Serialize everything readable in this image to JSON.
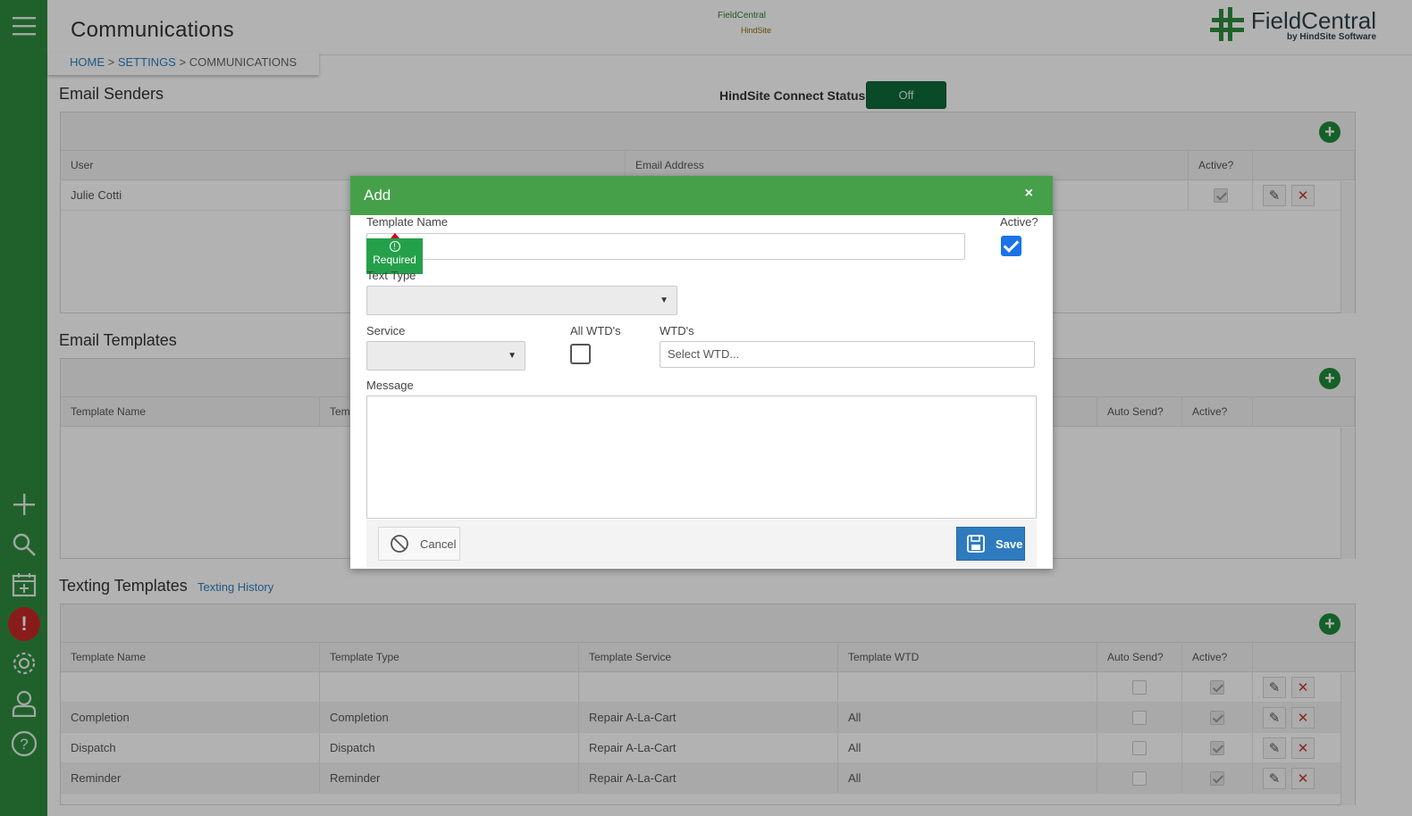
{
  "page": {
    "title": "Communications",
    "breadcrumb": {
      "home": "HOME",
      "settings": "SETTINGS",
      "current": "COMMUNICATIONS",
      "sep": ">"
    },
    "center_logo": {
      "top": "FieldCentral",
      "bottom": "HindSite"
    },
    "brand": {
      "name": "FieldCentral",
      "sub": "by HindSite Software"
    }
  },
  "email_senders": {
    "title": "Email Senders",
    "connect_label": "HindSite Connect Status:",
    "connect_value": "Off",
    "columns": [
      "User",
      "Email Address",
      "Active?"
    ],
    "rows": [
      {
        "user": "Julie Cotti",
        "email": "",
        "active": true
      }
    ]
  },
  "email_templates": {
    "title": "Email Templates",
    "columns": [
      "Template Name",
      "Tem",
      "Auto Send?",
      "Active?"
    ]
  },
  "texting_templates": {
    "title": "Texting Templates",
    "history_link": "Texting History",
    "columns": [
      "Template Name",
      "Template Type",
      "Template Service",
      "Template WTD",
      "Auto Send?",
      "Active?"
    ],
    "rows": [
      {
        "name": "",
        "type": "",
        "service": "",
        "wtd": ""
      },
      {
        "name": "Completion",
        "type": "Completion",
        "service": "Repair A-La-Cart",
        "wtd": "All"
      },
      {
        "name": "Dispatch",
        "type": "Dispatch",
        "service": "Repair A-La-Cart",
        "wtd": "All"
      },
      {
        "name": "Reminder",
        "type": "Reminder",
        "service": "Repair A-La-Cart",
        "wtd": "All"
      }
    ]
  },
  "modal": {
    "title": "Add",
    "close": "×",
    "template_name_label": "Template Name",
    "required_text": "Required",
    "active_label": "Active?",
    "active_checked": true,
    "text_type_label": "Text Type",
    "service_label": "Service",
    "all_wtds_label": "All WTD's",
    "wtds_label": "WTD's",
    "wtds_placeholder": "Select WTD...",
    "message_label": "Message",
    "cancel_label": "Cancel",
    "save_label": "Save"
  },
  "colors": {
    "rail": "#2e8b3e",
    "modal_header": "#46a04a",
    "save": "#2e7bbf",
    "status_btn": "#0e6b3a"
  }
}
